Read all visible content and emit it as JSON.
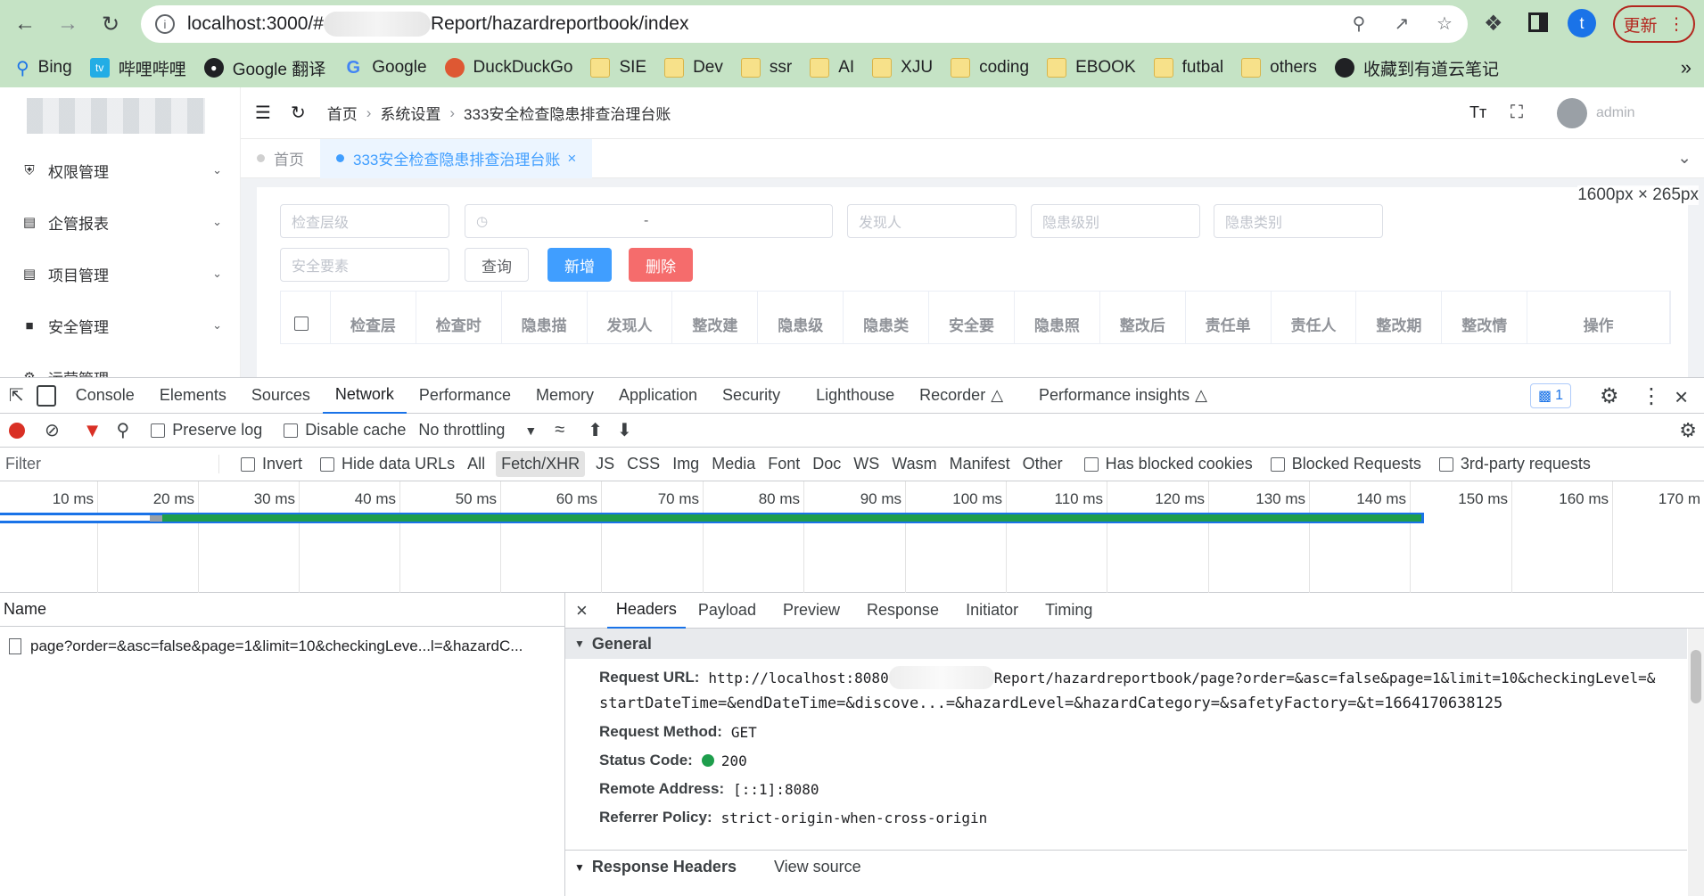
{
  "browser": {
    "url_prefix": "localhost:3000/#",
    "url_suffix": "Report/hazardreportbook/index",
    "update_label": "更新",
    "profile_initial": "t",
    "bookmarks": [
      {
        "label": "Bing",
        "icon": "search-icon"
      },
      {
        "label": "哔哩哔哩",
        "icon": "bilibili-icon"
      },
      {
        "label": "Google 翻译",
        "icon": "globe-icon"
      },
      {
        "label": "Google",
        "icon": "google-icon"
      },
      {
        "label": "DuckDuckGo",
        "icon": "duck-icon"
      },
      {
        "label": "SIE",
        "icon": "folder-icon"
      },
      {
        "label": "Dev",
        "icon": "folder-icon"
      },
      {
        "label": "ssr",
        "icon": "folder-icon"
      },
      {
        "label": "AI",
        "icon": "folder-icon"
      },
      {
        "label": "XJU",
        "icon": "folder-icon"
      },
      {
        "label": "coding",
        "icon": "folder-icon"
      },
      {
        "label": "EBOOK",
        "icon": "folder-icon"
      },
      {
        "label": "futbal",
        "icon": "folder-icon"
      },
      {
        "label": "others",
        "icon": "folder-icon"
      },
      {
        "label": "收藏到有道云笔记",
        "icon": "globe-icon"
      }
    ],
    "overflow": "»"
  },
  "app": {
    "sidebar": [
      "权限管理",
      "企管报表",
      "项目管理",
      "安全管理",
      "运营管理"
    ],
    "breadcrumb": [
      "首页",
      "系统设置",
      "333安全检查隐患排查治理台账"
    ],
    "user": "admin",
    "viewport_badge": "1600px × 265px",
    "tabs": [
      "首页",
      "333安全检查隐患排查治理台账"
    ],
    "filters": {
      "level": "检查层级",
      "date_sep": "-",
      "finder": "发现人",
      "hazard_level": "隐患级别",
      "hazard_category": "隐患类别",
      "safety_factor": "安全要素"
    },
    "buttons": {
      "query": "查询",
      "add": "新增",
      "delete": "删除"
    },
    "columns": [
      "检查层",
      "检查时",
      "隐患描",
      "发现人",
      "整改建",
      "隐患级",
      "隐患类",
      "安全要",
      "隐患照",
      "整改后",
      "责任单",
      "责任人",
      "整改期",
      "整改情",
      "操作"
    ]
  },
  "devtools": {
    "tabs": [
      "Console",
      "Elements",
      "Sources",
      "Network",
      "Performance",
      "Memory",
      "Application",
      "Security",
      "Lighthouse",
      "Recorder",
      "Performance insights"
    ],
    "issues_count": "1",
    "toolbar": {
      "preserve_log": "Preserve log",
      "disable_cache": "Disable cache",
      "throttling": "No throttling"
    },
    "filter": {
      "placeholder": "Filter",
      "invert": "Invert",
      "hide_data_urls": "Hide data URLs",
      "types": [
        "All",
        "Fetch/XHR",
        "JS",
        "CSS",
        "Img",
        "Media",
        "Font",
        "Doc",
        "WS",
        "Wasm",
        "Manifest",
        "Other"
      ],
      "has_blocked_cookies": "Has blocked cookies",
      "blocked_requests": "Blocked Requests",
      "third_party": "3rd-party requests"
    },
    "timeline_ticks": [
      "10 ms",
      "20 ms",
      "30 ms",
      "40 ms",
      "50 ms",
      "60 ms",
      "70 ms",
      "80 ms",
      "90 ms",
      "100 ms",
      "110 ms",
      "120 ms",
      "130 ms",
      "140 ms",
      "150 ms",
      "160 ms",
      "170 m"
    ],
    "name_header": "Name",
    "request_name": "page?order=&asc=false&page=1&limit=10&checkingLeve...l=&hazardC...",
    "detail_tabs": [
      "Headers",
      "Payload",
      "Preview",
      "Response",
      "Initiator",
      "Timing"
    ],
    "general": {
      "title": "General",
      "request_url_label": "Request URL:",
      "request_url_1a": "http://localhost:8080",
      "request_url_1b": "Report/hazardreportbook/page?order=&asc=false&page=1&limit=10&checkingLevel=&",
      "request_url_2": "startDateTime=&endDateTime=&discove...=&hazardLevel=&hazardCategory=&safetyFactory=&t=1664170638125",
      "method_label": "Request Method:",
      "method": "GET",
      "status_label": "Status Code:",
      "status": "200",
      "remote_label": "Remote Address:",
      "remote": "[::1]:8080",
      "referrer_label": "Referrer Policy:",
      "referrer": "strict-origin-when-cross-origin"
    },
    "response_headers": {
      "title": "Response Headers",
      "view_source": "View source"
    }
  }
}
